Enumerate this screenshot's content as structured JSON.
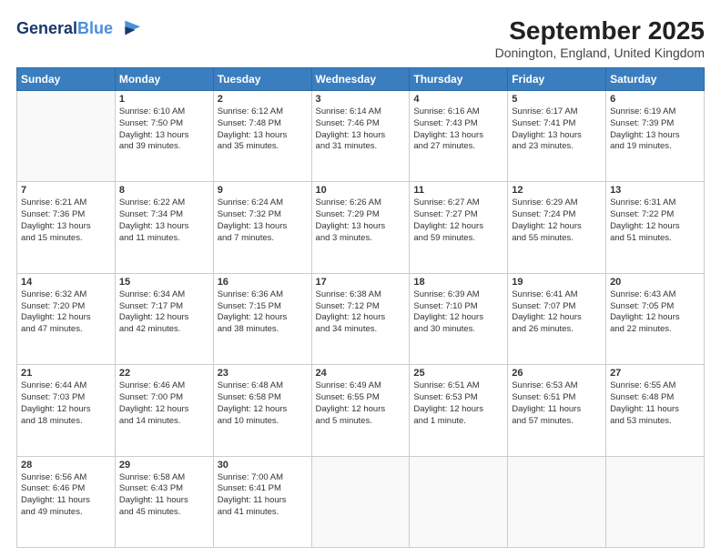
{
  "header": {
    "logo_line1": "General",
    "logo_line2": "Blue",
    "title": "September 2025",
    "subtitle": "Donington, England, United Kingdom"
  },
  "days_of_week": [
    "Sunday",
    "Monday",
    "Tuesday",
    "Wednesday",
    "Thursday",
    "Friday",
    "Saturday"
  ],
  "weeks": [
    [
      {
        "day": "",
        "lines": []
      },
      {
        "day": "1",
        "lines": [
          "Sunrise: 6:10 AM",
          "Sunset: 7:50 PM",
          "Daylight: 13 hours",
          "and 39 minutes."
        ]
      },
      {
        "day": "2",
        "lines": [
          "Sunrise: 6:12 AM",
          "Sunset: 7:48 PM",
          "Daylight: 13 hours",
          "and 35 minutes."
        ]
      },
      {
        "day": "3",
        "lines": [
          "Sunrise: 6:14 AM",
          "Sunset: 7:46 PM",
          "Daylight: 13 hours",
          "and 31 minutes."
        ]
      },
      {
        "day": "4",
        "lines": [
          "Sunrise: 6:16 AM",
          "Sunset: 7:43 PM",
          "Daylight: 13 hours",
          "and 27 minutes."
        ]
      },
      {
        "day": "5",
        "lines": [
          "Sunrise: 6:17 AM",
          "Sunset: 7:41 PM",
          "Daylight: 13 hours",
          "and 23 minutes."
        ]
      },
      {
        "day": "6",
        "lines": [
          "Sunrise: 6:19 AM",
          "Sunset: 7:39 PM",
          "Daylight: 13 hours",
          "and 19 minutes."
        ]
      }
    ],
    [
      {
        "day": "7",
        "lines": [
          "Sunrise: 6:21 AM",
          "Sunset: 7:36 PM",
          "Daylight: 13 hours",
          "and 15 minutes."
        ]
      },
      {
        "day": "8",
        "lines": [
          "Sunrise: 6:22 AM",
          "Sunset: 7:34 PM",
          "Daylight: 13 hours",
          "and 11 minutes."
        ]
      },
      {
        "day": "9",
        "lines": [
          "Sunrise: 6:24 AM",
          "Sunset: 7:32 PM",
          "Daylight: 13 hours",
          "and 7 minutes."
        ]
      },
      {
        "day": "10",
        "lines": [
          "Sunrise: 6:26 AM",
          "Sunset: 7:29 PM",
          "Daylight: 13 hours",
          "and 3 minutes."
        ]
      },
      {
        "day": "11",
        "lines": [
          "Sunrise: 6:27 AM",
          "Sunset: 7:27 PM",
          "Daylight: 12 hours",
          "and 59 minutes."
        ]
      },
      {
        "day": "12",
        "lines": [
          "Sunrise: 6:29 AM",
          "Sunset: 7:24 PM",
          "Daylight: 12 hours",
          "and 55 minutes."
        ]
      },
      {
        "day": "13",
        "lines": [
          "Sunrise: 6:31 AM",
          "Sunset: 7:22 PM",
          "Daylight: 12 hours",
          "and 51 minutes."
        ]
      }
    ],
    [
      {
        "day": "14",
        "lines": [
          "Sunrise: 6:32 AM",
          "Sunset: 7:20 PM",
          "Daylight: 12 hours",
          "and 47 minutes."
        ]
      },
      {
        "day": "15",
        "lines": [
          "Sunrise: 6:34 AM",
          "Sunset: 7:17 PM",
          "Daylight: 12 hours",
          "and 42 minutes."
        ]
      },
      {
        "day": "16",
        "lines": [
          "Sunrise: 6:36 AM",
          "Sunset: 7:15 PM",
          "Daylight: 12 hours",
          "and 38 minutes."
        ]
      },
      {
        "day": "17",
        "lines": [
          "Sunrise: 6:38 AM",
          "Sunset: 7:12 PM",
          "Daylight: 12 hours",
          "and 34 minutes."
        ]
      },
      {
        "day": "18",
        "lines": [
          "Sunrise: 6:39 AM",
          "Sunset: 7:10 PM",
          "Daylight: 12 hours",
          "and 30 minutes."
        ]
      },
      {
        "day": "19",
        "lines": [
          "Sunrise: 6:41 AM",
          "Sunset: 7:07 PM",
          "Daylight: 12 hours",
          "and 26 minutes."
        ]
      },
      {
        "day": "20",
        "lines": [
          "Sunrise: 6:43 AM",
          "Sunset: 7:05 PM",
          "Daylight: 12 hours",
          "and 22 minutes."
        ]
      }
    ],
    [
      {
        "day": "21",
        "lines": [
          "Sunrise: 6:44 AM",
          "Sunset: 7:03 PM",
          "Daylight: 12 hours",
          "and 18 minutes."
        ]
      },
      {
        "day": "22",
        "lines": [
          "Sunrise: 6:46 AM",
          "Sunset: 7:00 PM",
          "Daylight: 12 hours",
          "and 14 minutes."
        ]
      },
      {
        "day": "23",
        "lines": [
          "Sunrise: 6:48 AM",
          "Sunset: 6:58 PM",
          "Daylight: 12 hours",
          "and 10 minutes."
        ]
      },
      {
        "day": "24",
        "lines": [
          "Sunrise: 6:49 AM",
          "Sunset: 6:55 PM",
          "Daylight: 12 hours",
          "and 5 minutes."
        ]
      },
      {
        "day": "25",
        "lines": [
          "Sunrise: 6:51 AM",
          "Sunset: 6:53 PM",
          "Daylight: 12 hours",
          "and 1 minute."
        ]
      },
      {
        "day": "26",
        "lines": [
          "Sunrise: 6:53 AM",
          "Sunset: 6:51 PM",
          "Daylight: 11 hours",
          "and 57 minutes."
        ]
      },
      {
        "day": "27",
        "lines": [
          "Sunrise: 6:55 AM",
          "Sunset: 6:48 PM",
          "Daylight: 11 hours",
          "and 53 minutes."
        ]
      }
    ],
    [
      {
        "day": "28",
        "lines": [
          "Sunrise: 6:56 AM",
          "Sunset: 6:46 PM",
          "Daylight: 11 hours",
          "and 49 minutes."
        ]
      },
      {
        "day": "29",
        "lines": [
          "Sunrise: 6:58 AM",
          "Sunset: 6:43 PM",
          "Daylight: 11 hours",
          "and 45 minutes."
        ]
      },
      {
        "day": "30",
        "lines": [
          "Sunrise: 7:00 AM",
          "Sunset: 6:41 PM",
          "Daylight: 11 hours",
          "and 41 minutes."
        ]
      },
      {
        "day": "",
        "lines": []
      },
      {
        "day": "",
        "lines": []
      },
      {
        "day": "",
        "lines": []
      },
      {
        "day": "",
        "lines": []
      }
    ]
  ]
}
